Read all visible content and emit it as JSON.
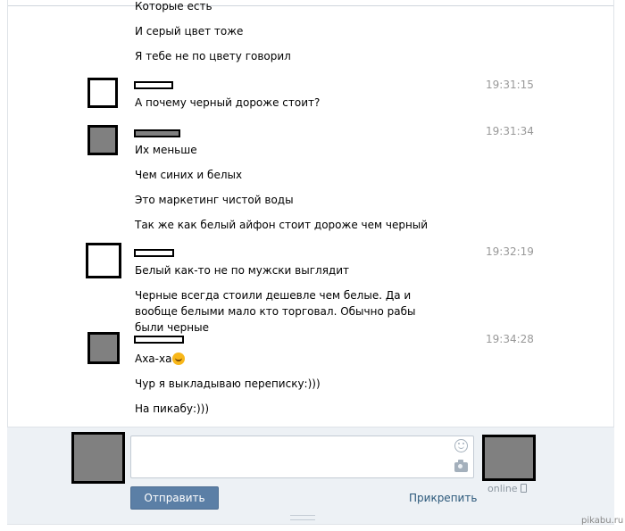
{
  "messages": {
    "m1": "Которые есть",
    "m2": "И серый цвет тоже",
    "m3": "Я тебе не по цвету говорил",
    "m4": "А почему черный дороже стоит?",
    "m5": "Их меньше",
    "m6": "Чем синих и белых",
    "m7": "Это маркетинг чистой воды",
    "m8": "Так же как белый айфон стоит дороже чем черный",
    "m9": "Белый как-то не по мужски выглядит",
    "m10": "Черные всегда стоили дешевле чем белые. Да и вообще белыми мало кто торговал. Обычно рабы были черные",
    "m11": "Аха-ха",
    "m12": "Чур я выкладываю переписку:)))",
    "m13": "На пикабу:)))"
  },
  "times": {
    "t1": "19:31:15",
    "t2": "19:31:34",
    "t3": "19:32:19",
    "t4": "19:34:28"
  },
  "emoji": "laughing-face",
  "composer": {
    "placeholder": "",
    "send_label": "Отправить",
    "attach_label": "Прикрепить",
    "online_label": "online"
  },
  "watermark": "pikabu.ru",
  "colors": {
    "send_button": "#5b7fa6",
    "link": "#2b587a",
    "timestamp": "#999999",
    "composer_bg": "#edf1f5",
    "redaction_fill": "#808080"
  }
}
